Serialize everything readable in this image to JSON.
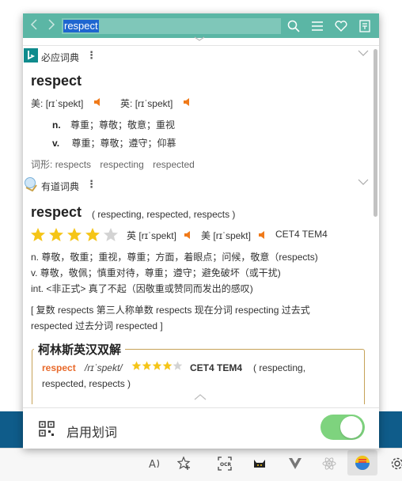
{
  "search": {
    "query": "respect"
  },
  "bing": {
    "name": "必应词典",
    "word": "respect",
    "us_label": "美:",
    "us_phonetic": "[rɪˈspekt]",
    "uk_label": "英:",
    "uk_phonetic": "[rɪˈspekt]",
    "definitions": [
      {
        "pos": "n.",
        "meaning": "尊重；尊敬；敬意；重视"
      },
      {
        "pos": "v.",
        "meaning": "尊重；尊敬；遵守；仰慕"
      }
    ],
    "forms_label": "词形:",
    "forms": [
      "respects",
      "respecting",
      "respected"
    ]
  },
  "youdao": {
    "name": "有道词典",
    "word": "respect",
    "inflections": "( respecting, respected, respects )",
    "star_rating": 4,
    "star_max": 5,
    "uk_label": "英",
    "uk_phonetic": "[rɪˈspekt]",
    "us_label": "美",
    "us_phonetic": "[rɪˈspekt]",
    "levels": "CET4 TEM4",
    "definitions": [
      "n. 尊敬，敬重；重视，尊重；方面，着眼点；问候，敬意（respects)",
      "v. 尊敬，敬佩；慎重对待，尊重；遵守；避免破坏（或干扰)",
      "int. <非正式> 真了不起（因敬重或赞同而发出的感叹)"
    ],
    "morph_line1": "[ 复数 respects 第三人称单数 respects 现在分词 respecting 过去式",
    "morph_line2": "respected 过去分词 respected ]"
  },
  "collins": {
    "title": "柯林斯英汉双解",
    "word": "respect",
    "phonetic": "/rɪˈspekt/",
    "star_rating": 4,
    "star_max": 5,
    "levels": "CET4 TEM4",
    "inflections_a": "( respecting,",
    "inflections_b": "respected, respects )"
  },
  "bottom": {
    "label": "启用划词",
    "toggle_on": true
  },
  "colors": {
    "topbar": "#5bb6a5",
    "star_on": "#f5c518",
    "star_off": "#d3d3d3",
    "speaker": "#f07a1a",
    "collins_word": "#e8692a",
    "toggle": "#7ed37e",
    "bing_logo": "#0f8b8d"
  }
}
